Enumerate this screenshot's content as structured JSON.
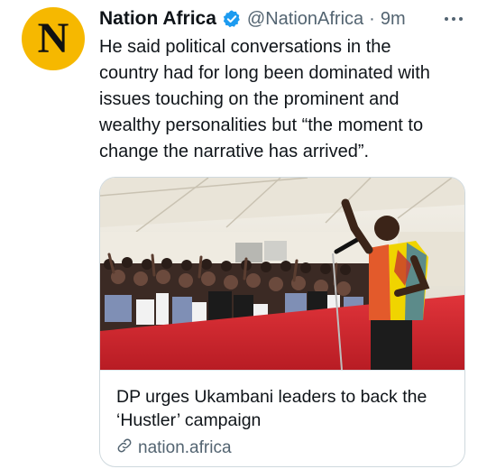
{
  "tweet": {
    "avatar_letter": "N",
    "author_name": "Nation Africa",
    "author_handle": "@NationAfrica",
    "separator": "·",
    "timestamp": "9m",
    "text": "He said political conversations in the\ncountry had for long been dominated with\nissues touching on the prominent and\nwealthy personalities but “the moment to\nchange the narrative has arrived”."
  },
  "card": {
    "title": "DP urges Ukambani leaders to back the\n‘Hustler’ campaign",
    "domain": "nation.africa"
  },
  "icons": {
    "verified": "verified-badge-icon",
    "more": "more-options-icon",
    "link": "link-icon"
  },
  "colors": {
    "avatar_bg": "#f6b800",
    "verified": "#1d9bf0",
    "secondary_text": "#536471",
    "carpet": "#d8262f"
  }
}
